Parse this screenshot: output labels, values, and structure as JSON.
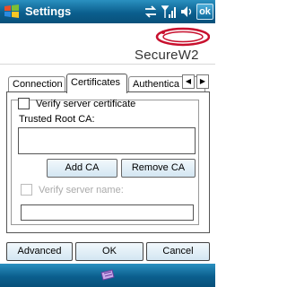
{
  "titlebar": {
    "title": "Settings",
    "ok_label": "ok"
  },
  "icons": [
    "windows-start-flag-icon",
    "connectivity-icon",
    "signal-strength-icon",
    "speaker-icon",
    "keyboard-icon"
  ],
  "logo": {
    "text": "SecureW2"
  },
  "tabs": [
    {
      "label": "Connection",
      "active": false
    },
    {
      "label": "Certificates",
      "active": true
    },
    {
      "label": "Authentica",
      "active": false
    }
  ],
  "certificates": {
    "verify_server_certificate": {
      "label": "Verify server certificate",
      "checked": false
    },
    "trusted_root_ca_label": "Trusted Root CA:",
    "trusted_root_ca_value": "",
    "add_ca_label": "Add CA",
    "remove_ca_label": "Remove CA",
    "verify_server_name": {
      "label": "Verify server name:",
      "checked": false,
      "enabled": false
    },
    "server_name_value": ""
  },
  "buttons": {
    "advanced": "Advanced",
    "ok": "OK",
    "cancel": "Cancel"
  },
  "colors": {
    "titlebar": "#0b5f8e",
    "logo_red": "#c8102e"
  }
}
